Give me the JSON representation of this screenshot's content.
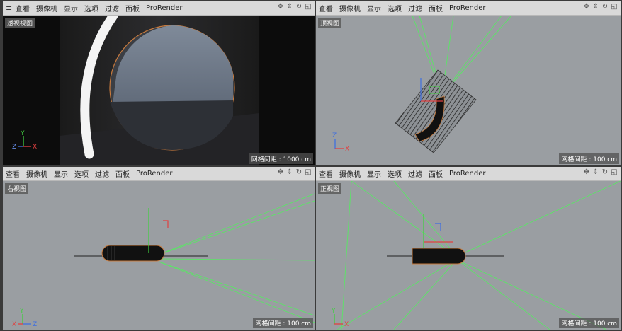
{
  "menu": [
    "查看",
    "摄像机",
    "显示",
    "选项",
    "过滤",
    "面板",
    "ProRender"
  ],
  "nav_icons": [
    "move-icon",
    "zoom-icon",
    "rotate-icon",
    "maximize-icon"
  ],
  "nav_glyphs": [
    "✥",
    "⇕",
    "↻",
    "◱"
  ],
  "viewports": {
    "perspective": {
      "title": "透视视图",
      "grid": "网格间距 : 1000 cm"
    },
    "top": {
      "title": "顶视图",
      "grid": "网格间距 : 100 cm"
    },
    "right": {
      "title": "右视图",
      "grid": "网格间距 : 100 cm"
    },
    "front": {
      "title": "正视图",
      "grid": "网格间距 : 100 cm"
    }
  },
  "axes": {
    "x": "X",
    "y": "Y",
    "z": "Z"
  },
  "colors": {
    "menubar": "#d9d9d9",
    "viewport_bg": "#9a9ea2",
    "light_line": "#5fe06a",
    "axis_x": "#e04040",
    "axis_y": "#3fcf3f",
    "axis_z": "#3f6fe0",
    "selection": "#e08a3a"
  }
}
